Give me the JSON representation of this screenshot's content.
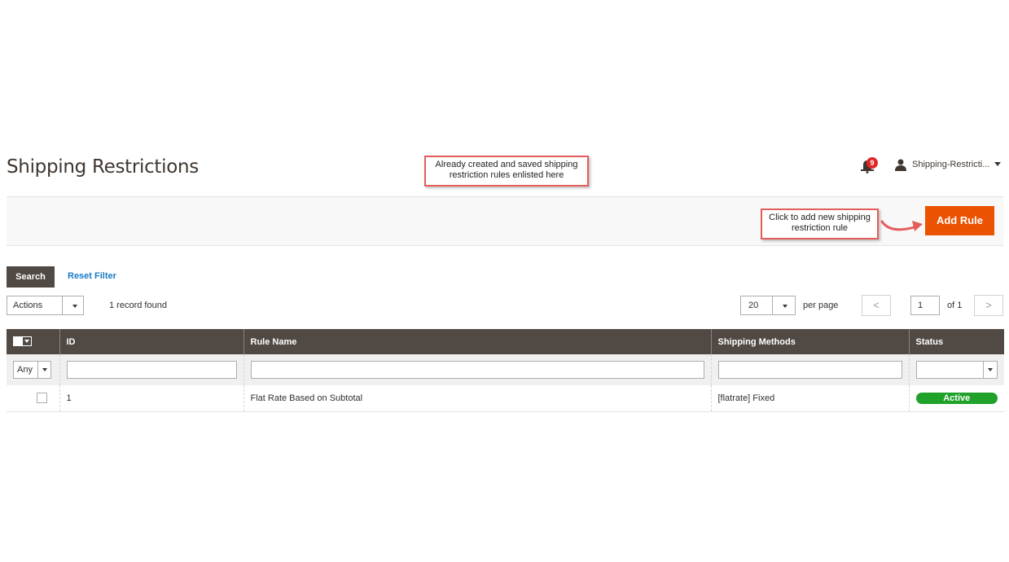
{
  "header": {
    "title": "Shipping Restrictions",
    "notifications_count": "9",
    "user_name": "Shipping-Restricti..."
  },
  "callouts": {
    "top": "Already created and saved shipping restriction rules enlisted here",
    "add_rule": "Click to add new shipping restriction rule"
  },
  "toolbar": {
    "add_rule_label": "Add Rule"
  },
  "filters": {
    "search_label": "Search",
    "reset_label": "Reset Filter"
  },
  "grid_controls": {
    "actions_label": "Actions",
    "records_found": "1 record found",
    "per_page_value": "20",
    "per_page_label": "per page",
    "prev_label": "<",
    "next_label": ">",
    "page_value": "1",
    "page_of": "of 1"
  },
  "table": {
    "columns": [
      "ID",
      "Rule Name",
      "Shipping Methods",
      "Status"
    ],
    "filter_any": "Any",
    "rows": [
      {
        "id": "1",
        "rule_name": "Flat Rate Based on Subtotal",
        "shipping_methods": "[flatrate] Fixed",
        "status": "Active"
      }
    ]
  },
  "colors": {
    "accent": "#eb5202",
    "header_bg": "#514943",
    "status_active": "#1fa12a",
    "link": "#1979c3",
    "callout_border": "#e35d5b"
  }
}
